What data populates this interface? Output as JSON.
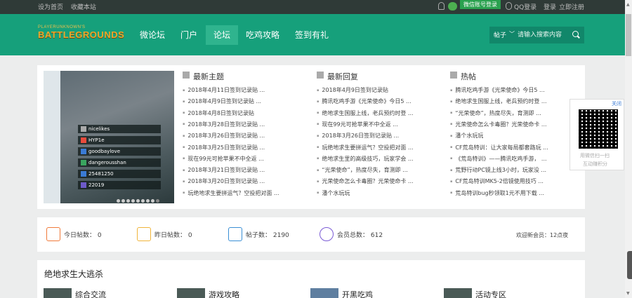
{
  "topbar": {
    "set_home": "设为首页",
    "bookmark": "收藏本站",
    "wechat_login": "微信账号登录",
    "qq_login": "QQ登录",
    "login": "登录",
    "register": "立即注册"
  },
  "header": {
    "logo_line1": "PLAYERUNKNOWN'S",
    "logo_line2": "BATTLEGROUNDS",
    "nav": [
      {
        "label": "微论坛",
        "active": false
      },
      {
        "label": "门户",
        "active": false
      },
      {
        "label": "论坛",
        "active": true
      },
      {
        "label": "吃鸡攻略",
        "active": false
      },
      {
        "label": "签到有礼",
        "active": false
      }
    ],
    "search": {
      "scope": "帖子",
      "placeholder": "请输入搜索内容"
    }
  },
  "slider": {
    "players": [
      "nicelikes",
      "HYP1e",
      "goodbaylove",
      "dangerousshan",
      "25481250",
      "22019"
    ],
    "dot_count": 9,
    "active_dot": 8
  },
  "columns": [
    {
      "title": "最新主题",
      "items": [
        "2018年4月11日签到记录贴 ...",
        "2018年4月9日签到记录贴 ...",
        "2018年4月8日签到记录贴",
        "2018年3月28日签到记录贴 ...",
        "2018年3月26日签到记录贴 ...",
        "2018年3月25日签到记录贴 ...",
        "现在99元可抢苹果不中全返 ...",
        "2018年3月21日签到记录贴 ...",
        "2018年3月20日签到记录贴 ...",
        "玩绝地求生要拼运气？空投把对面 ..."
      ]
    },
    {
      "title": "最新回复",
      "items": [
        "2018年4月9日签到记录贴",
        "腾讯吃鸡手游《光荣使命》今日5 ...",
        "绝地求生国服上线，老兵预约时登 ...",
        "现在99元可抢苹果不中全返 ...",
        "2018年3月26日签到记录贴 ...",
        "玩绝地求生要拼运气？空投把对面 ...",
        "绝地求生里的高级技巧，玩家学会 ...",
        "“光荣使命”，热度尽失，育测即 ...",
        "光荣使命怎么卡毒圈？光荣使命卡 ...",
        "潘个水玩玩"
      ]
    },
    {
      "title": "热帖",
      "items": [
        "腾讯吃鸡手游《光荣使命》今日5 ...",
        "绝地求生国服上线，老兵预约时登 ...",
        "“光荣使命”，热度尽失，育测即 ...",
        "光荣使命怎么卡毒圈？光荣使命卡 ...",
        "潘个水玩玩",
        "CF荒岛特训：让大家每局都套路玩 ...",
        "《荒岛特训》——腾讯吃鸡手游， ...",
        "荒野行动PC镜上线3小时，玩家没 ...",
        "CF荒岛特训MK5-2倍镜使用技巧 ...",
        "荒岛特训bug秒领取1元不用下载 ..."
      ]
    }
  ],
  "qr": {
    "close": "关闭",
    "caption1": "用微信扫一扫",
    "caption2": "互动赚积分"
  },
  "stats": {
    "today": "今日帖数： 0",
    "yesterday": "昨日帖数： 0",
    "posts": "帖子数： 2190",
    "members": "会员总数： 612",
    "welcome": "欢迎新会员：12点夜"
  },
  "section": {
    "title": "绝地求生大逃杀",
    "forums": [
      "综合交流",
      "游戏攻略",
      "开黑吃鸡",
      "活动专区"
    ]
  },
  "colors": {
    "header": "#16a07b",
    "topbar": "#2f3a37",
    "nav_active": "#2fb48e"
  }
}
